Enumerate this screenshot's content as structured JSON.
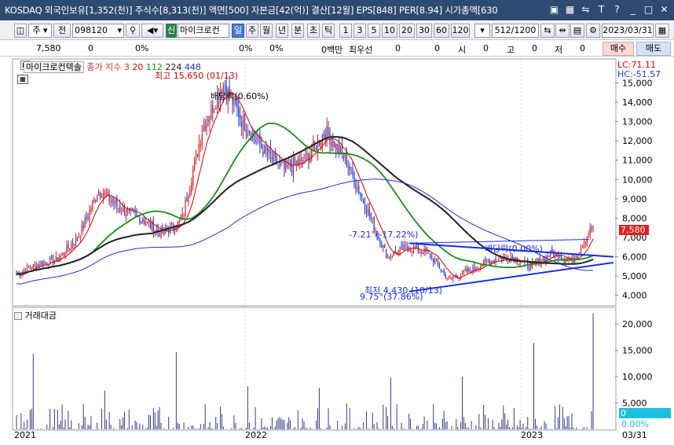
{
  "window": {
    "title": "KOSDAQ 외국인보유[1,352(천)] 주식수[8,313(천)] 액면[500] 자본금[42(억)] 결산[12월] EPS[848] PER[8.94] 시가총액[630"
  },
  "toolbar": {
    "period_unit": "주",
    "prev_label": "전",
    "stock_code": "098120",
    "new_tag": "신",
    "stock_name": "마이크로컨",
    "periods": [
      "일",
      "주",
      "월",
      "년",
      "분",
      "초",
      "틱"
    ],
    "active_period": "일",
    "intervals": [
      "1",
      "3",
      "5",
      "10",
      "20",
      "30",
      "60",
      "120"
    ],
    "count": "512/1200",
    "date": "2023/03/31"
  },
  "quote": {
    "price": "7,580",
    "change": "0",
    "change_pct": "0%",
    "v1": "0%",
    "v2": "0%",
    "volume_label": "0백만",
    "pref_label": "최우선",
    "pref_v1": "0",
    "pref_v2": "0",
    "open_label": "시",
    "open": "0",
    "high_label": "고",
    "high": "0",
    "low_label": "저",
    "low": "0",
    "buy": "매수",
    "sell": "매도"
  },
  "chart": {
    "legend_name": "마이크로컨텍솔",
    "legend_ma_label": "종가 지수 3",
    "ma_periods": [
      "20",
      "112",
      "224",
      "448"
    ],
    "lc": "LC:71.11",
    "hc": "HC:-51.57",
    "annotations": {
      "high": "최고 15,650 (01/13)",
      "low": "최저 4,430 (10/13)",
      "div1": "배당락(0.60%)",
      "div2": "배당락(0.00%)",
      "trend1": "-7.21°(-17.22%)",
      "trend2": "9.75°(37.86%)"
    },
    "price_tag": "7,580",
    "volume_title": "거래대금",
    "volume_tag": "0",
    "volume_pct": "0.00%",
    "x_labels": [
      "2021",
      "2022",
      "2023"
    ],
    "x_end": "03/31"
  },
  "chart_data": {
    "type": "candlestick",
    "price_axis": {
      "ticks": [
        "15,000",
        "14,000",
        "13,000",
        "12,000",
        "11,000",
        "10,000",
        "9,000",
        "8,000",
        "7,000",
        "6,000",
        "5,000",
        "4,000"
      ],
      "ylim": [
        3500,
        16200
      ]
    },
    "volume_axis": {
      "ticks": [
        "20,000",
        "15,000",
        "10,000",
        "5,000"
      ],
      "ylim": [
        0,
        23000
      ]
    },
    "approx_close_path": [
      5100,
      5600,
      5900,
      7000,
      9500,
      8500,
      8000,
      7200,
      7800,
      12500,
      15000,
      13000,
      11500,
      10500,
      11000,
      12500,
      11000,
      8500,
      6000,
      6500,
      6200,
      4800,
      5300,
      5800,
      6000,
      5500,
      6200,
      5800,
      7580
    ],
    "colors": {
      "up": "#e0201e",
      "down": "#1d3fd6",
      "ma20": "#d40000",
      "ma112": "#1d8a1d",
      "ma224": "#222222",
      "ma448": "#2233cc",
      "trendline": "#1b2ee0",
      "price_tag_bg": "#e0201e",
      "volume_tag_bg": "#19c0e0"
    }
  }
}
